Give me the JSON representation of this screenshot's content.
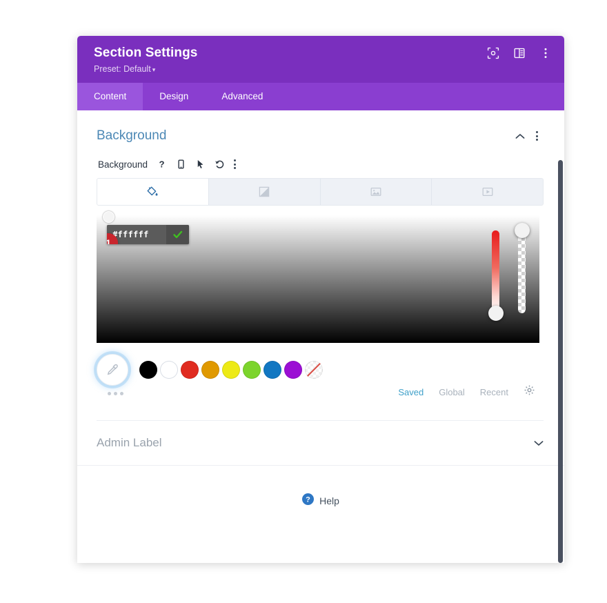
{
  "header": {
    "title": "Section Settings",
    "preset_label": "Preset: Default",
    "caret": "▾",
    "icons": [
      {
        "name": "focus-target-icon"
      },
      {
        "name": "split-view-icon"
      },
      {
        "name": "more-vertical-icon"
      }
    ]
  },
  "tabs": [
    {
      "label": "Content",
      "active": true
    },
    {
      "label": "Design",
      "active": false
    },
    {
      "label": "Advanced",
      "active": false
    }
  ],
  "background_section": {
    "title": "Background",
    "collapse_icon": "chevron-up-icon",
    "menu_icon": "more-vertical-icon",
    "field_label": "Background",
    "field_icons": [
      {
        "name": "help-icon",
        "glyph": "?"
      },
      {
        "name": "mobile-icon"
      },
      {
        "name": "cursor-icon"
      },
      {
        "name": "reset-icon"
      },
      {
        "name": "more-vertical-icon"
      }
    ],
    "type_tabs": [
      {
        "name": "background-color-tab",
        "icon": "paint-bucket-icon",
        "active": true
      },
      {
        "name": "background-gradient-tab",
        "icon": "gradient-icon",
        "active": false
      },
      {
        "name": "background-image-tab",
        "icon": "image-icon",
        "active": false
      },
      {
        "name": "background-video-tab",
        "icon": "video-icon",
        "active": false
      }
    ],
    "color_picker": {
      "hex_value": "#ffffff",
      "hex_placeholder": "#ffffff",
      "confirm_icon": "check-icon",
      "step_badge": "1",
      "badge_color": "#c9252d",
      "hue_slider": "hue-slider",
      "alpha_slider": "alpha-slider",
      "eyedropper_icon": "eyedropper-icon",
      "more_dots": "more-swatches-icon"
    },
    "swatches": [
      {
        "name": "swatch-black",
        "color": "#000000"
      },
      {
        "name": "swatch-white",
        "color": "#ffffff"
      },
      {
        "name": "swatch-red",
        "color": "#e02b20"
      },
      {
        "name": "swatch-orange",
        "color": "#e09900"
      },
      {
        "name": "swatch-yellow",
        "color": "#edea16"
      },
      {
        "name": "swatch-green",
        "color": "#7cd42c"
      },
      {
        "name": "swatch-blue",
        "color": "#1277c2"
      },
      {
        "name": "swatch-purple",
        "color": "#9b0fd4"
      },
      {
        "name": "swatch-transparent",
        "color": "transparent"
      }
    ],
    "palette_links": [
      {
        "label": "Saved",
        "active": true
      },
      {
        "label": "Global",
        "active": false
      },
      {
        "label": "Recent",
        "active": false
      }
    ],
    "settings_icon": "gear-icon"
  },
  "admin_label_section": {
    "title": "Admin Label",
    "expand_icon": "chevron-down-icon"
  },
  "help": {
    "label": "Help",
    "icon": "help-circle-icon"
  },
  "footer": [
    {
      "name": "cancel-button",
      "glyph": "✖",
      "color": "#eb5c55"
    },
    {
      "name": "undo-button",
      "glyph": "↺",
      "color": "#7a2fbe"
    },
    {
      "name": "redo-button",
      "glyph": "↻",
      "color": "#2e8bd0"
    },
    {
      "name": "save-button",
      "glyph": "✔",
      "color": "#2cc6a0"
    }
  ]
}
